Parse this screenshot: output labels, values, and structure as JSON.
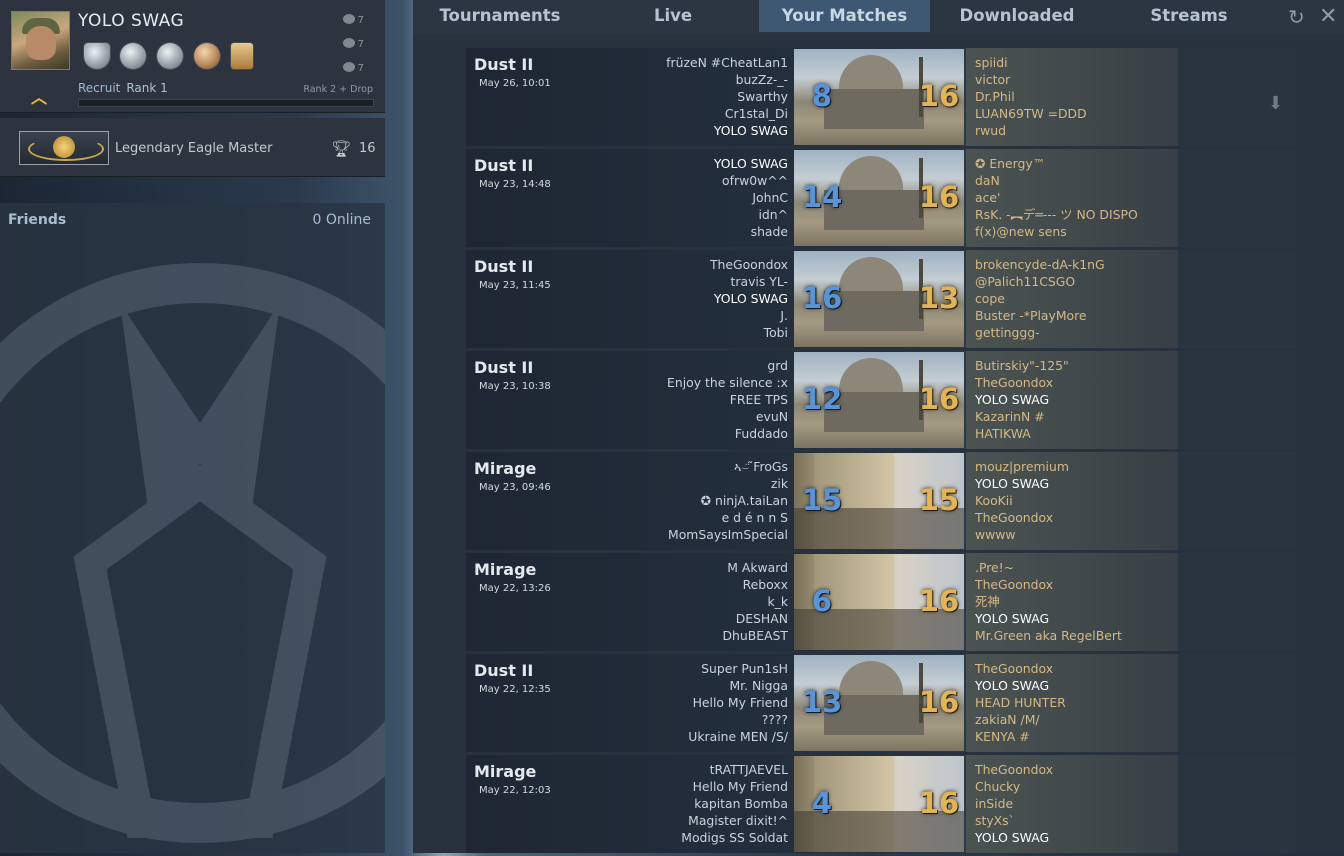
{
  "profile": {
    "username": "YOLO SWAG",
    "commendations": [
      "7",
      "7",
      "7"
    ],
    "rank_label": "Recruit",
    "rank_value": "Rank 1",
    "rank_next": "Rank 2 + Drop",
    "rank_progress": 0,
    "medals": [
      "service-medal-icon",
      "veteran-coin-icon",
      "operation-coin-icon",
      "bronze-coin-icon",
      "map-coin-icon"
    ]
  },
  "skill": {
    "group": "Legendary Eagle Master",
    "wins": "16"
  },
  "friends": {
    "title": "Friends",
    "online": "0 Online"
  },
  "tabs": [
    "Tournaments",
    "Live",
    "Your Matches",
    "Downloaded",
    "Streams"
  ],
  "active_tab": "Your Matches",
  "matches": [
    {
      "map": "Dust II",
      "date": "May 26, 10:01",
      "score_ct": "8",
      "score_t": "16",
      "team1": [
        "früzeN #CheatLan1",
        "buzZz-_-",
        "Swarthy",
        "Cr1stal_Di",
        "YOLO SWAG"
      ],
      "team2": [
        "spiidi",
        "victor",
        "Dr.Phil",
        "LUAN69TW =DDD",
        "rwud"
      ]
    },
    {
      "map": "Dust II",
      "date": "May 23, 14:48",
      "score_ct": "14",
      "score_t": "16",
      "team1": [
        "YOLO SWAG",
        "ofrw0w^^",
        "JohnC",
        "idn^",
        "shade"
      ],
      "team2": [
        "✪ Energy™",
        "daN",
        "ace'",
        "RsK. -︻デ═--- ツ NO DISPO",
        "f(x)@new sens"
      ]
    },
    {
      "map": "Dust II",
      "date": "May 23, 11:45",
      "score_ct": "16",
      "score_t": "13",
      "team1": [
        "TheGoondox",
        "travis YL-",
        "YOLO SWAG",
        "J.",
        "Tobi"
      ],
      "team2": [
        "brokencyde-dA-k1nG",
        "@Palich11CSGO",
        "cope",
        "Buster -*PlayMore",
        "gettinggg-"
      ]
    },
    {
      "map": "Dust II",
      "date": "May 23, 10:38",
      "score_ct": "12",
      "score_t": "16",
      "team1": [
        "grd",
        "Enjoy the silence :x",
        "FREE TPS",
        "evuN",
        "Fuddado"
      ],
      "team2": [
        "Butirskiy\"-125\"",
        "TheGoondox",
        "YOLO SWAG",
        "KazarinN #",
        "HATIKWA"
      ]
    },
    {
      "map": "Mirage",
      "date": "May 23, 09:46",
      "score_ct": "15",
      "score_t": "15",
      "team1": [
        "ኣ⌣̈ ̃FroGs",
        "zik",
        "✪ ninjA.taiLan",
        "e d é n n S",
        "MomSaysImSpecial"
      ],
      "team2": [
        "mouz|premium",
        "YOLO SWAG",
        "KooKii",
        "TheGoondox",
        "wwww"
      ]
    },
    {
      "map": "Mirage",
      "date": "May 22, 13:26",
      "score_ct": "6",
      "score_t": "16",
      "team1": [
        "M Akward",
        "Reboxx",
        "k_k",
        "DESHAN",
        "DhuBEAST"
      ],
      "team2": [
        ".Pre!~",
        "TheGoondox",
        "死神",
        "YOLO SWAG",
        "Mr.Green aka RegelBert"
      ]
    },
    {
      "map": "Dust II",
      "date": "May 22, 12:35",
      "score_ct": "13",
      "score_t": "16",
      "team1": [
        "Super Pun1sH",
        "Mr. Nigga",
        "Hello My Friend",
        "????",
        "Ukraine MEN /S/"
      ],
      "team2": [
        "TheGoondox",
        "YOLO SWAG",
        "HEAD HUNTER",
        "zakiaN /M/",
        "KENYA #"
      ]
    },
    {
      "map": "Mirage",
      "date": "May 22, 12:03",
      "score_ct": "4",
      "score_t": "16",
      "team1": [
        "tRATTJAEVEL",
        "Hello My Friend",
        "kapitan Bomba",
        "Magister dixit!^",
        "Modigs SS Soldat"
      ],
      "team2": [
        "TheGoondox",
        "Chucky",
        "inSide",
        "styXs`",
        "YOLO SWAG"
      ]
    }
  ],
  "colors": {
    "ct": "#5b94d6",
    "t": "#e0b45a",
    "active_tab": "#3e5873"
  }
}
